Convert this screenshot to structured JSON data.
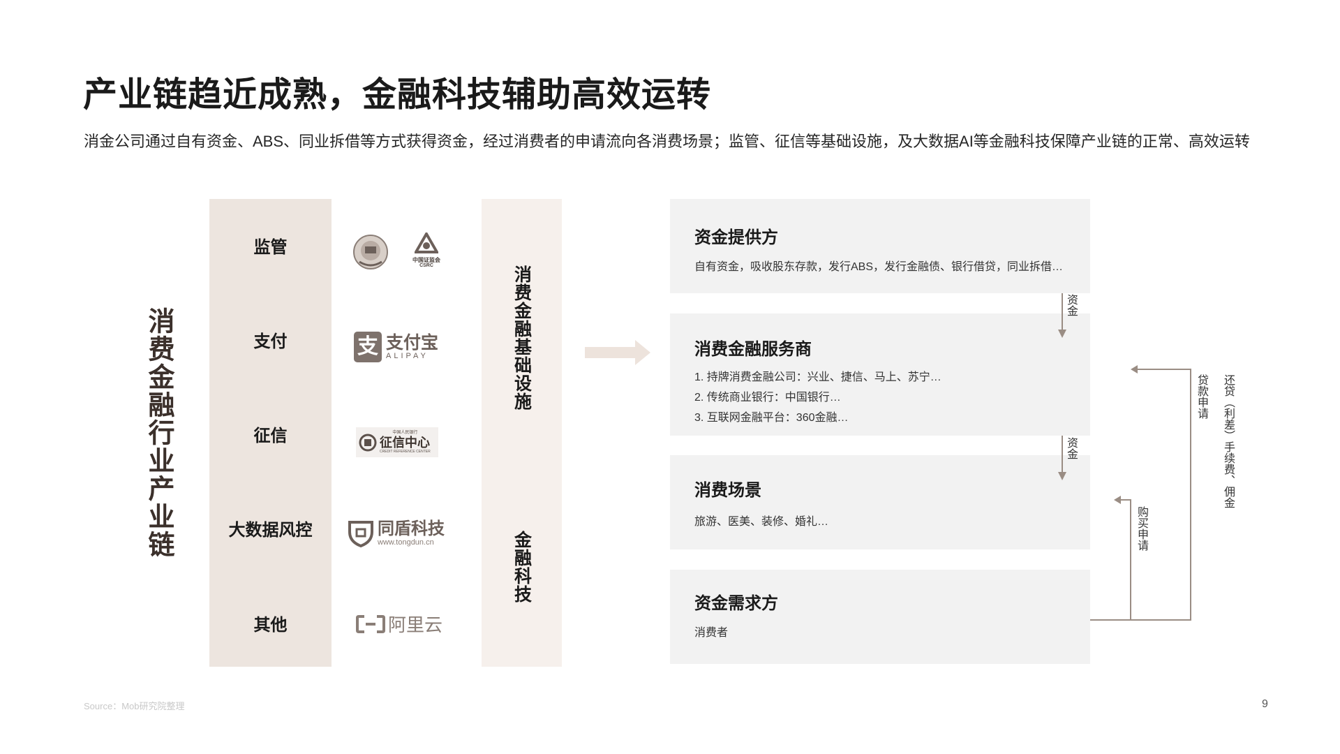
{
  "title": "产业链趋近成熟，金融科技辅助高效运转",
  "subtitle": "消金公司通过自有资金、ABS、同业拆借等方式获得资金，经过消费者的申请流向各消费场景；监管、征信等基础设施，及大数据AI等金融科技保障产业链的正常、高效运转",
  "diagram": {
    "chain_label": "消费金融行业产业链",
    "categories": [
      {
        "label": "监管",
        "logo": "police-emblem-and-csrc-logo",
        "logo_text": "中国证监会",
        "logo_text2": "CSRC"
      },
      {
        "label": "支付",
        "logo": "alipay-logo",
        "logo_text": "支付宝",
        "logo_text2": "ALIPAY"
      },
      {
        "label": "征信",
        "logo": "credit-reference-center-logo",
        "logo_text": "征信中心",
        "logo_text2": "CREDIT REFERENCE CENTER",
        "logo_text3": "中国人民银行"
      },
      {
        "label": "大数据风控",
        "logo": "tongdun-logo",
        "logo_text": "同盾科技",
        "logo_text2": "www.tongdun.cn"
      },
      {
        "label": "其他",
        "logo": "aliyun-logo",
        "logo_text": "阿里云"
      }
    ],
    "infra_labels": [
      "消费金融基础设施",
      "金融科技"
    ],
    "boxes": [
      {
        "title": "资金提供方",
        "desc": "自有资金，吸收股东存款，发行ABS，发行金融债、银行借贷，同业拆借…"
      },
      {
        "title": "消费金融服务商",
        "items": [
          "1. 持牌消费金融公司：兴业、捷信、马上、苏宁…",
          "2. 传统商业银行：中国银行…",
          "3. 互联网金融平台：360金融…"
        ]
      },
      {
        "title": "消费场景",
        "desc": "旅游、医美、装修、婚礼…"
      },
      {
        "title": "资金需求方",
        "desc": "消费者"
      }
    ],
    "flow_labels": {
      "fund_1": "资金",
      "fund_2": "资金",
      "purchase_apply": "购买申请",
      "loan_apply": "贷款申请",
      "repay": "还贷（利差）手续费、佣金"
    }
  },
  "source": "Source：Mob研究院整理",
  "page_number": "9",
  "colors": {
    "accent": "#9a8d84",
    "category_bg": "#ede5df",
    "infra_bg": "#f6f0ec",
    "box_bg": "#f2f2f2",
    "arrow": "#ede3dc"
  }
}
